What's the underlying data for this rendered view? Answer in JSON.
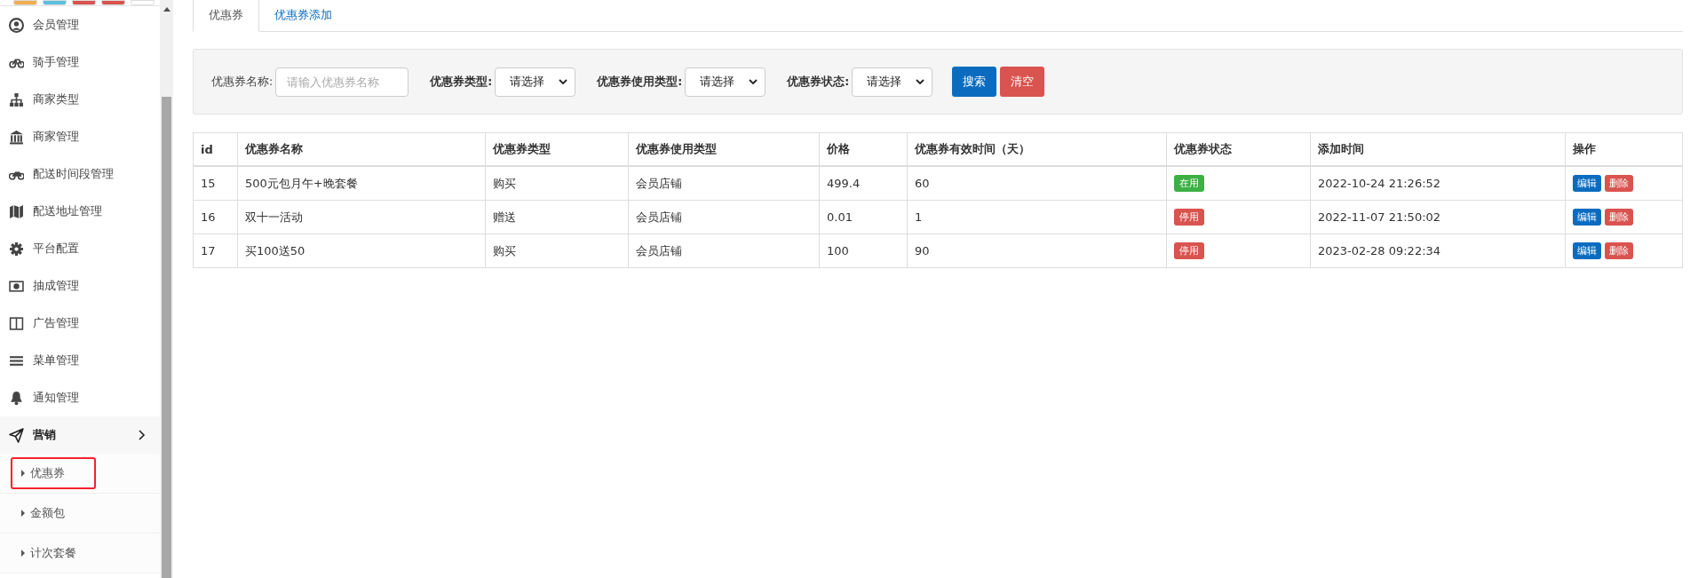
{
  "top_buttons": [
    {
      "color": "#f0ad4e"
    },
    {
      "color": "#5bc0de"
    },
    {
      "color": "#d9534f"
    },
    {
      "color": "#d9534f"
    },
    {
      "color": "#ffffff"
    }
  ],
  "sidebar": {
    "items": [
      {
        "label": "会员管理",
        "expanded": false
      },
      {
        "label": "骑手管理",
        "expanded": false
      },
      {
        "label": "商家类型",
        "expanded": false
      },
      {
        "label": "商家管理",
        "expanded": false
      },
      {
        "label": "配送时间段管理",
        "expanded": false
      },
      {
        "label": "配送地址管理",
        "expanded": false
      },
      {
        "label": "平台配置",
        "expanded": false
      },
      {
        "label": "抽成管理",
        "expanded": false
      },
      {
        "label": "广告管理",
        "expanded": false
      },
      {
        "label": "菜单管理",
        "expanded": false
      },
      {
        "label": "通知管理",
        "expanded": false
      },
      {
        "label": "营销",
        "expanded": true,
        "children": [
          {
            "label": "优惠券",
            "selected": true
          },
          {
            "label": "金额包",
            "selected": false
          },
          {
            "label": "计次套餐",
            "selected": false
          }
        ]
      }
    ]
  },
  "tabs": [
    {
      "label": "优惠券",
      "selected": true
    },
    {
      "label": "优惠券添加",
      "selected": false
    }
  ],
  "filters": [
    {
      "kind": "input",
      "label": "优惠券名称:",
      "placeholder": "请输入优惠券名称"
    },
    {
      "kind": "select",
      "label": "优惠券类型:",
      "value": "请选择"
    },
    {
      "kind": "select",
      "label": "优惠券使用类型:",
      "value": "请选择"
    },
    {
      "kind": "select",
      "label": "优惠券状态:",
      "value": "请选择"
    }
  ],
  "filter_buttons": [
    {
      "label": "搜索",
      "kind": "primary"
    },
    {
      "label": "清空",
      "kind": "danger"
    }
  ],
  "table": {
    "columns": [
      "id",
      "优惠券名称",
      "优惠券类型",
      "优惠券使用类型",
      "价格",
      "优惠券有效时间（天）",
      "优惠券状态",
      "添加时间",
      "操作"
    ],
    "rows": [
      {
        "id": "15",
        "name": "500元包月午+晚套餐",
        "type": "购买",
        "use_type": "会员店铺",
        "price": "499.4",
        "days": "60",
        "status": "在用",
        "in_use": true,
        "added": "2022-10-24 21:26:52",
        "actions": [
          "编辑",
          "删除"
        ]
      },
      {
        "id": "16",
        "name": "双十一活动",
        "type": "赠送",
        "use_type": "会员店铺",
        "price": "0.01",
        "days": "1",
        "status": "停用",
        "in_use": false,
        "added": "2022-11-07 21:50:02",
        "actions": [
          "编辑",
          "删除"
        ]
      },
      {
        "id": "17",
        "name": "买100送50",
        "type": "购买",
        "use_type": "会员店铺",
        "price": "100",
        "days": "90",
        "status": "停用",
        "in_use": false,
        "added": "2023-02-28 09:22:34",
        "actions": [
          "编辑",
          "删除"
        ]
      }
    ]
  }
}
